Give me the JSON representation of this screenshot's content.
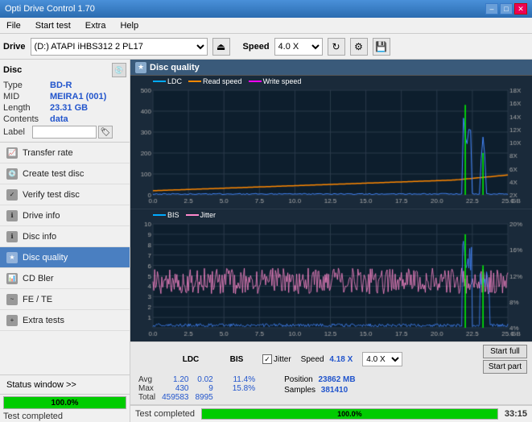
{
  "titlebar": {
    "title": "Opti Drive Control 1.70",
    "min_label": "–",
    "max_label": "□",
    "close_label": "✕"
  },
  "menubar": {
    "items": [
      "File",
      "Start test",
      "Extra",
      "Help"
    ]
  },
  "toolbar": {
    "drive_label": "Drive",
    "drive_value": "(D:) ATAPI iHBS312  2 PL17",
    "speed_label": "Speed",
    "speed_value": "4.0 X"
  },
  "sidebar": {
    "disc_section": {
      "title": "Disc",
      "fields": [
        {
          "label": "Type",
          "value": "BD-R"
        },
        {
          "label": "MID",
          "value": "MEIRA1 (001)"
        },
        {
          "label": "Length",
          "value": "23.31 GB"
        },
        {
          "label": "Contents",
          "value": "data"
        }
      ],
      "label_text": "Label"
    },
    "nav_items": [
      {
        "id": "transfer-rate",
        "label": "Transfer rate",
        "active": false
      },
      {
        "id": "create-test-disc",
        "label": "Create test disc",
        "active": false
      },
      {
        "id": "verify-test-disc",
        "label": "Verify test disc",
        "active": false
      },
      {
        "id": "drive-info",
        "label": "Drive info",
        "active": false
      },
      {
        "id": "disc-info",
        "label": "Disc info",
        "active": false
      },
      {
        "id": "disc-quality",
        "label": "Disc quality",
        "active": true
      },
      {
        "id": "cd-bler",
        "label": "CD Bler",
        "active": false
      },
      {
        "id": "fe-te",
        "label": "FE / TE",
        "active": false
      },
      {
        "id": "extra-tests",
        "label": "Extra tests",
        "active": false
      }
    ],
    "status_window_label": "Status window >>",
    "progress_value": 100,
    "progress_text": "100.0%",
    "status_text": "Test completed"
  },
  "disc_quality": {
    "title": "Disc quality",
    "legend": {
      "ldc_label": "LDC",
      "read_speed_label": "Read speed",
      "write_speed_label": "Write speed"
    },
    "legend2": {
      "bis_label": "BIS",
      "jitter_label": "Jitter"
    },
    "top_chart": {
      "y_max": 500,
      "y_labels": [
        "500",
        "400",
        "300",
        "200",
        "100",
        "0"
      ],
      "y_right_labels": [
        "18X",
        "16X",
        "14X",
        "12X",
        "10X",
        "8X",
        "6X",
        "4X",
        "2X"
      ],
      "x_labels": [
        "0.0",
        "2.5",
        "5.0",
        "7.5",
        "10.0",
        "12.5",
        "15.0",
        "17.5",
        "20.0",
        "22.5",
        "25.0"
      ],
      "x_unit": "GB"
    },
    "bottom_chart": {
      "y_max": 10,
      "y_labels": [
        "10",
        "9",
        "8",
        "7",
        "6",
        "5",
        "4",
        "3",
        "2",
        "1"
      ],
      "y_right_labels": [
        "20%",
        "16%",
        "12%",
        "8%",
        "4%"
      ],
      "x_labels": [
        "0.0",
        "2.5",
        "5.0",
        "7.5",
        "10.0",
        "12.5",
        "15.0",
        "17.5",
        "20.0",
        "22.5",
        "25.0"
      ],
      "x_unit": "GB"
    },
    "stats": {
      "columns": [
        "LDC",
        "BIS"
      ],
      "jitter_label": "Jitter",
      "jitter_checked": true,
      "speed_label": "Speed",
      "speed_value": "4.18 X",
      "speed_select": "4.0 X",
      "rows": [
        {
          "label": "Avg",
          "ldc": "1.20",
          "bis": "0.02",
          "jitter": "11.4%"
        },
        {
          "label": "Max",
          "ldc": "430",
          "bis": "9",
          "jitter": "15.8%"
        },
        {
          "label": "Total",
          "ldc": "459583",
          "bis": "8995",
          "jitter": ""
        }
      ],
      "position_label": "Position",
      "position_value": "23862 MB",
      "samples_label": "Samples",
      "samples_value": "381410",
      "start_full_label": "Start full",
      "start_part_label": "Start part"
    }
  },
  "bottom_bar": {
    "status": "Test completed",
    "progress": 100,
    "progress_text": "100.0%",
    "time": "33:15"
  }
}
